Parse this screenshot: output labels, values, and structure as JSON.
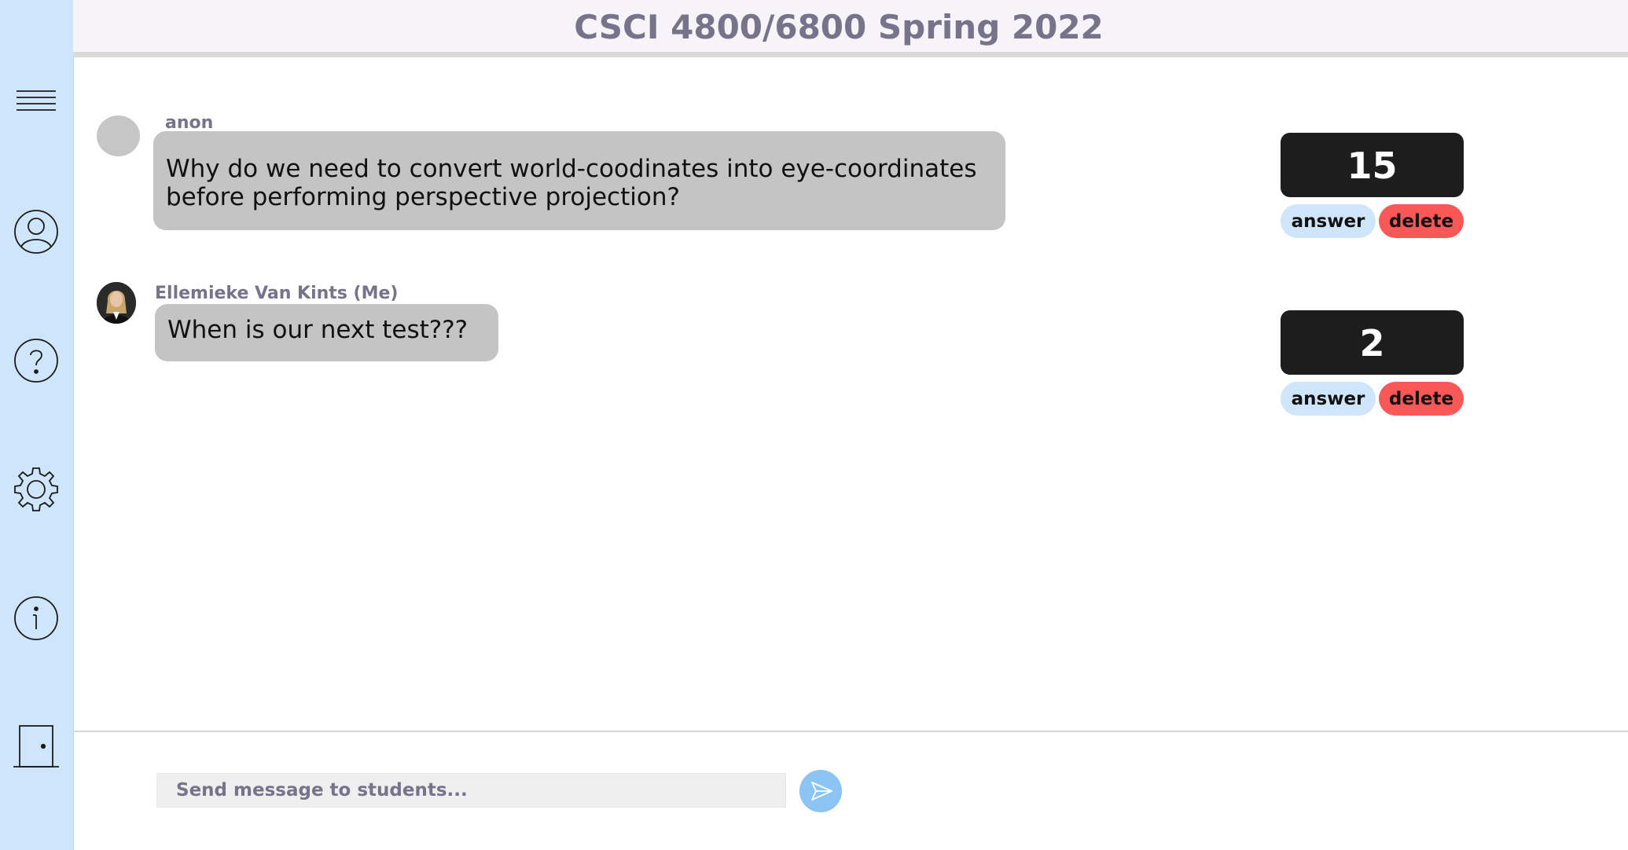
{
  "header": {
    "title": "CSCI 4800/6800 Spring 2022"
  },
  "sidebar": {
    "items": [
      {
        "icon": "menu-icon"
      },
      {
        "icon": "profile-icon"
      },
      {
        "icon": "help-icon"
      },
      {
        "icon": "settings-icon"
      },
      {
        "icon": "info-icon"
      },
      {
        "icon": "logout-door-icon"
      }
    ]
  },
  "questions": [
    {
      "author": "anon",
      "text": "Why do we need to convert world-coodinates into eye-coordinates before performing perspective projection?",
      "votes": "15",
      "answer_label": "answer",
      "delete_label": "delete"
    },
    {
      "author": "Ellemieke Van Kints (Me)",
      "text": "When is our next test???",
      "votes": "2",
      "answer_label": "answer",
      "delete_label": "delete"
    }
  ],
  "composer": {
    "placeholder": "Send message to students..."
  },
  "colors": {
    "sidebar_bg": "#cfe5fa",
    "header_bg": "#f6f3f9",
    "title_text": "#76738a",
    "bubble_bg": "#c4c4c4",
    "score_bg": "#1d1d1d",
    "answer_bg": "#cfe5fa",
    "delete_bg": "#fa5858",
    "send_bg": "#8cc4f4"
  }
}
